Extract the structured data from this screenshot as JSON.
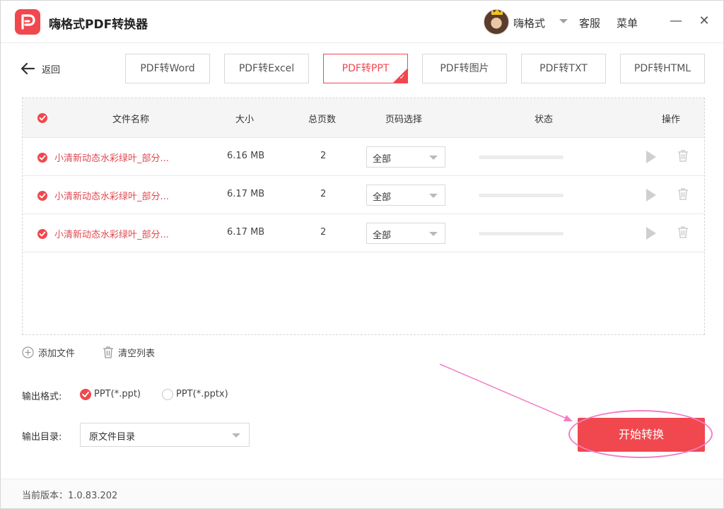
{
  "app": {
    "title": "嗨格式PDF转换器"
  },
  "user": {
    "name": "嗨格式"
  },
  "topbar": {
    "service": "客服",
    "menu": "菜单",
    "minimize": "—",
    "close": "✕"
  },
  "nav": {
    "back_label": "返回"
  },
  "tabs": [
    {
      "label": "PDF转Word",
      "active": false
    },
    {
      "label": "PDF转Excel",
      "active": false
    },
    {
      "label": "PDF转PPT",
      "active": true
    },
    {
      "label": "PDF转图片",
      "active": false
    },
    {
      "label": "PDF转TXT",
      "active": false
    },
    {
      "label": "PDF转HTML",
      "active": false
    }
  ],
  "table": {
    "headers": {
      "name": "文件名称",
      "size": "大小",
      "pages": "总页数",
      "range": "页码选择",
      "status": "状态",
      "ops": "操作"
    },
    "rows": [
      {
        "name": "小清新动态水彩绿叶_部分...",
        "size": "6.16 MB",
        "pages": "2",
        "range": "全部",
        "progress": 0
      },
      {
        "name": "小清新动态水彩绿叶_部分...",
        "size": "6.17 MB",
        "pages": "2",
        "range": "全部",
        "progress": 0
      },
      {
        "name": "小清新动态水彩绿叶_部分...",
        "size": "6.17 MB",
        "pages": "2",
        "range": "全部",
        "progress": 0
      }
    ]
  },
  "actions": {
    "add_file": "添加文件",
    "clear_list": "清空列表"
  },
  "output": {
    "format_label": "输出格式:",
    "format_options": [
      {
        "label": "PPT(*.ppt)",
        "selected": true
      },
      {
        "label": "PPT(*.pptx)",
        "selected": false
      }
    ],
    "dir_label": "输出目录:",
    "dir_value": "原文件目录"
  },
  "start_button": "开始转换",
  "footer": {
    "version_text": "当前版本：1.0.83.202"
  },
  "colors": {
    "accent": "#f0484e",
    "annotation": "#f27fc6"
  }
}
